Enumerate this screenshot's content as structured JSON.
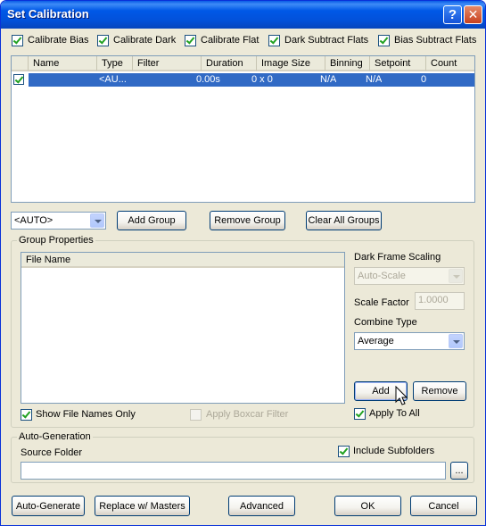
{
  "window": {
    "title": "Set Calibration",
    "help_glyph": "?",
    "close_glyph": "✕"
  },
  "options": [
    {
      "label": "Calibrate Bias",
      "checked": true
    },
    {
      "label": "Calibrate Dark",
      "checked": true
    },
    {
      "label": "Calibrate Flat",
      "checked": true
    },
    {
      "label": "Dark Subtract Flats",
      "checked": true
    },
    {
      "label": "Bias Subtract Flats",
      "checked": true
    }
  ],
  "groups_table": {
    "columns": [
      "Name",
      "Type",
      "Filter",
      "Duration",
      "Image Size",
      "Binning",
      "Setpoint",
      "Count"
    ],
    "rows": [
      {
        "checked": true,
        "name": "",
        "type": "<AU...",
        "filter": "",
        "duration": "0.00s",
        "image_size": "0 x 0",
        "binning": "N/A",
        "setpoint": "N/A",
        "count": "0"
      }
    ]
  },
  "group_toolbar": {
    "type_select": "<AUTO>",
    "add_group": "Add Group",
    "remove_group": "Remove Group",
    "clear_all_groups": "Clear All Groups"
  },
  "group_properties": {
    "title": "Group Properties",
    "file_list_header": "File Name",
    "show_file_names_only": "Show File Names Only",
    "apply_boxcar_filter": "Apply Boxcar Filter",
    "dark_frame_scaling_label": "Dark Frame Scaling",
    "dark_frame_scaling_value": "Auto-Scale",
    "scale_factor_label": "Scale Factor",
    "scale_factor_value": "1.0000",
    "combine_type_label": "Combine Type",
    "combine_type_value": "Average",
    "add": "Add",
    "remove": "Remove",
    "apply_to_all": "Apply To All"
  },
  "auto_generation": {
    "title": "Auto-Generation",
    "source_folder_label": "Source Folder",
    "source_folder_value": "",
    "include_subfolders": "Include Subfolders",
    "browse": "..."
  },
  "footer": {
    "auto_generate": "Auto-Generate",
    "replace_with_masters": "Replace w/ Masters",
    "advanced": "Advanced",
    "ok": "OK",
    "cancel": "Cancel"
  },
  "colors": {
    "titlebar": "#0058E7",
    "selection": "#316AC5",
    "dialog_bg": "#ECE9D8"
  }
}
